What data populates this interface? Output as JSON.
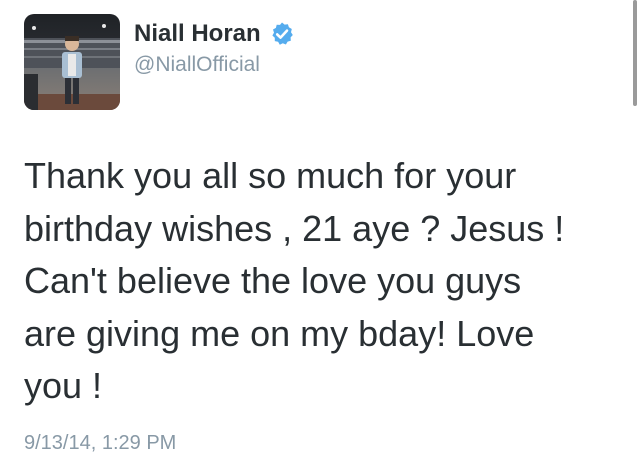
{
  "user": {
    "display_name": "Niall Horan",
    "handle": "@NiallOfficial",
    "verified": true,
    "avatar_icon": "profile-photo-stadium"
  },
  "tweet": {
    "text": "Thank you all so much for your\nbirthday wishes , 21 aye ? Jesus !\nCan't believe the love you guys\nare giving me on my bday! Love\nyou !",
    "timestamp": "9/13/14, 1:29 PM"
  },
  "colors": {
    "name": "#292f33",
    "muted": "#8899a6",
    "verified_badge": "#55acee"
  }
}
